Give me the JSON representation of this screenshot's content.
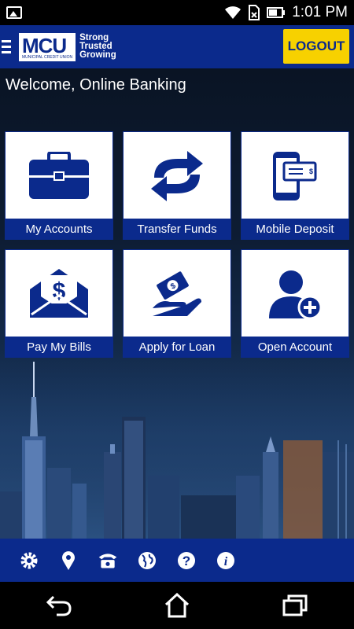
{
  "status_bar": {
    "time": "1:01 PM"
  },
  "header": {
    "logo_text": "MCU",
    "logo_subtext": "MUNICIPAL CREDIT UNION",
    "tagline": [
      "Strong",
      "Trusted",
      "Growing"
    ],
    "logout_label": "LOGOUT"
  },
  "welcome": "Welcome, Online Banking",
  "tiles": [
    {
      "label": "My Accounts",
      "icon": "briefcase-icon"
    },
    {
      "label": "Transfer Funds",
      "icon": "transfer-arrows-icon"
    },
    {
      "label": "Mobile Deposit",
      "icon": "mobile-deposit-icon"
    },
    {
      "label": "Pay My Bills",
      "icon": "bill-envelope-icon"
    },
    {
      "label": "Apply for Loan",
      "icon": "loan-hand-icon"
    },
    {
      "label": "Open Account",
      "icon": "add-user-icon"
    }
  ],
  "toolbar_icons": [
    "gear-icon",
    "location-pin-icon",
    "phone-icon",
    "globe-icon",
    "help-icon",
    "info-icon"
  ],
  "colors": {
    "brand_blue": "#0b2a8c",
    "logout_yellow": "#f7d100"
  }
}
